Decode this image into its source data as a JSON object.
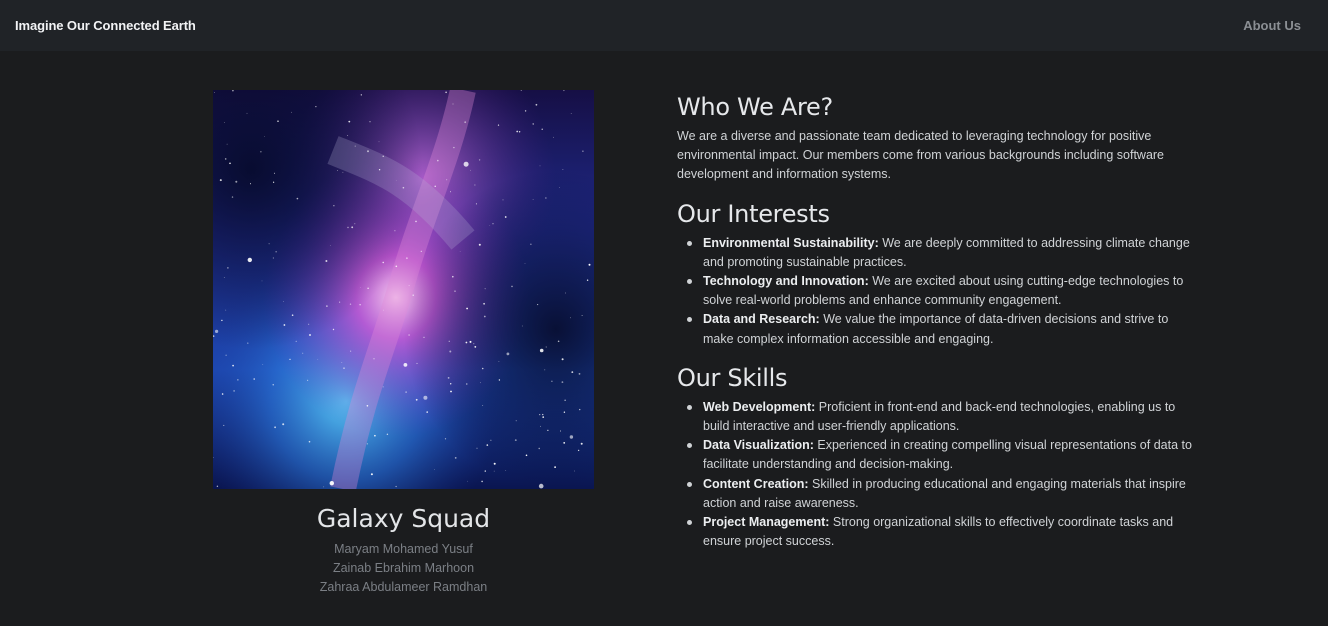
{
  "navbar": {
    "brand": "Imagine Our Connected Earth",
    "about_link": "About Us"
  },
  "team": {
    "name": "Galaxy Squad",
    "members": [
      "Maryam Mohamed Yusuf",
      "Zainab Ebrahim Marhoon",
      "Zahraa Abdulameer Ramdhan"
    ]
  },
  "who": {
    "title": "Who We Are?",
    "text": "We are a diverse and passionate team dedicated to leveraging technology for positive environmental impact. Our members come from various backgrounds including software development and information systems."
  },
  "interests": {
    "title": "Our Interests",
    "items": [
      {
        "term": "Environmental Sustainability:",
        "text": " We are deeply committed to addressing climate change and promoting sustainable practices."
      },
      {
        "term": "Technology and Innovation:",
        "text": " We are excited about using cutting-edge technologies to solve real-world problems and enhance community engagement."
      },
      {
        "term": "Data and Research:",
        "text": " We value the importance of data-driven decisions and strive to make complex information accessible and engaging."
      }
    ]
  },
  "skills": {
    "title": "Our Skills",
    "items": [
      {
        "term": "Web Development:",
        "text": " Proficient in front-end and back-end technologies, enabling us to build interactive and user-friendly applications."
      },
      {
        "term": "Data Visualization:",
        "text": " Experienced in creating compelling visual representations of data to facilitate understanding and decision-making."
      },
      {
        "term": "Content Creation:",
        "text": " Skilled in producing educational and engaging materials that inspire action and raise awareness."
      },
      {
        "term": "Project Management:",
        "text": " Strong organizational skills to effectively coordinate tasks and ensure project success."
      }
    ]
  }
}
